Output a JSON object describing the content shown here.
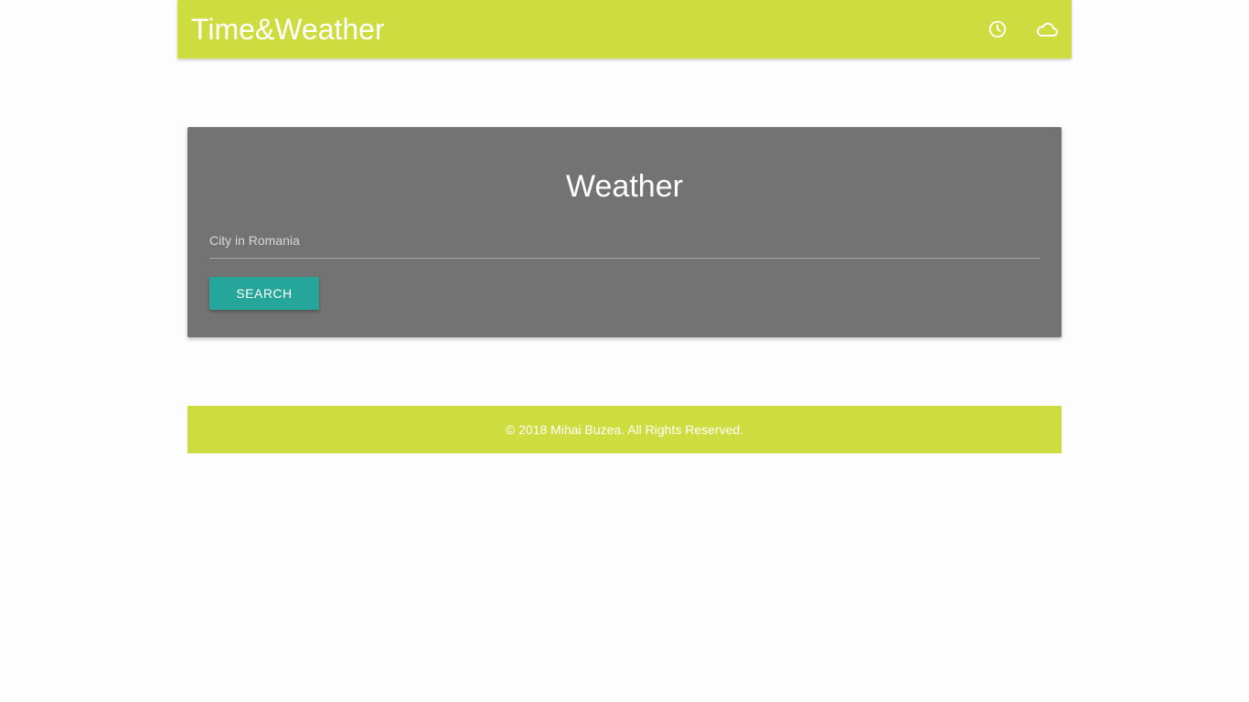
{
  "navbar": {
    "brand": "Time&Weather",
    "icons": [
      "clock-icon",
      "cloud-icon"
    ],
    "background_color": "#cddc3e"
  },
  "card": {
    "title": "Weather",
    "city_input": {
      "placeholder": "City in Romania",
      "value": ""
    },
    "search_label": "SEARCH",
    "background_color": "#737373",
    "button_color": "#26a69a"
  },
  "footer": {
    "text": "© 2018 Mihai Buzea. All Rights Reserved."
  }
}
